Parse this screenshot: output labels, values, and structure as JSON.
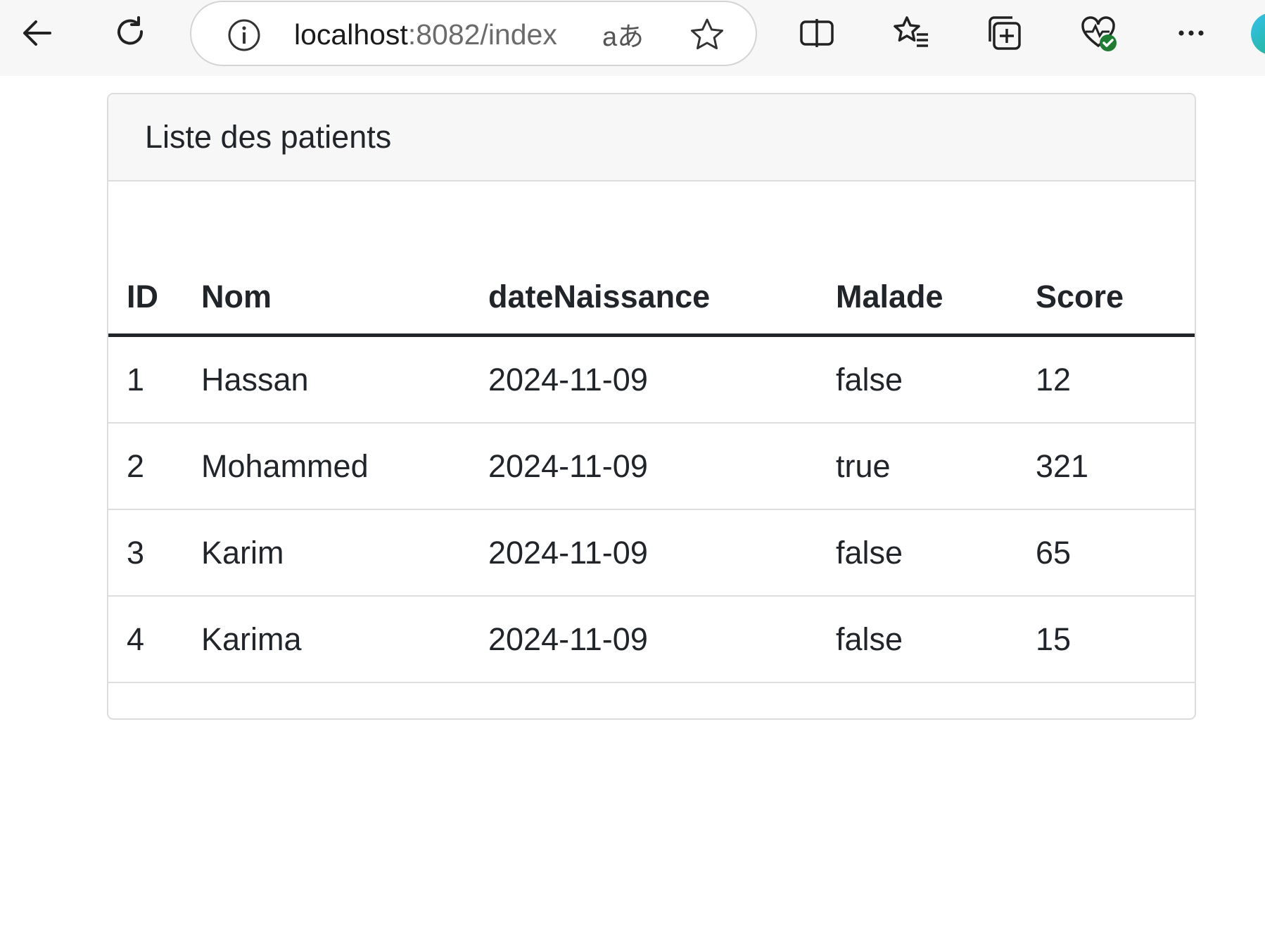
{
  "browser": {
    "url_host": "localhost",
    "url_rest": ":8082/index",
    "translate_glyph": "aあ",
    "colors": {
      "toolbar_bg": "#f7f7f7",
      "favorites_badge": "#1e7d32"
    }
  },
  "card": {
    "header": "Liste des patients"
  },
  "table": {
    "columns": [
      "ID",
      "Nom",
      "dateNaissance",
      "Malade",
      "Score"
    ],
    "rows": [
      [
        "1",
        "Hassan",
        "2024-11-09",
        "false",
        "12"
      ],
      [
        "2",
        "Mohammed",
        "2024-11-09",
        "true",
        "321"
      ],
      [
        "3",
        "Karim",
        "2024-11-09",
        "false",
        "65"
      ],
      [
        "4",
        "Karima",
        "2024-11-09",
        "false",
        "15"
      ]
    ]
  }
}
